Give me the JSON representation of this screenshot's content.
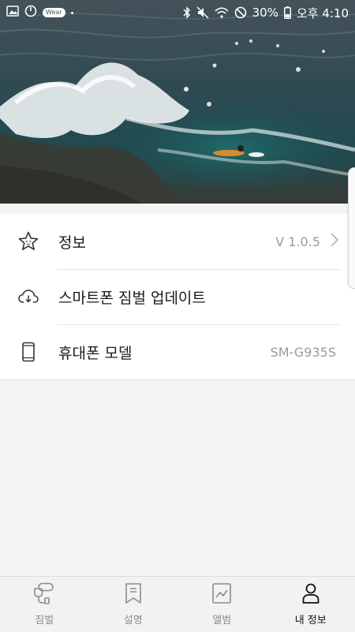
{
  "status_bar": {
    "wear_badge": "Wear",
    "battery": "30%",
    "time": "오후 4:10"
  },
  "hero": {
    "icon": "ocean-surf-photo"
  },
  "menu": {
    "items": [
      {
        "label": "정보",
        "value": "V 1.0.5",
        "icon": "star-icon",
        "has_chevron": true
      },
      {
        "label": "스마트폰 짐벌 업데이트",
        "value": "",
        "icon": "cloud-download-icon",
        "has_chevron": false
      },
      {
        "label": "휴대폰 모델",
        "value": "SM-G935S",
        "icon": "smartphone-icon",
        "has_chevron": false
      }
    ]
  },
  "bottom_nav": {
    "items": [
      {
        "label": "짐벌",
        "icon": "gimbal-icon",
        "active": false
      },
      {
        "label": "설명",
        "icon": "bookmark-icon",
        "active": false
      },
      {
        "label": "앨범",
        "icon": "album-icon",
        "active": false
      },
      {
        "label": "내 정보",
        "icon": "person-icon",
        "active": true
      }
    ],
    "active_color": "#111111",
    "inactive_color": "#8c8c8c"
  }
}
